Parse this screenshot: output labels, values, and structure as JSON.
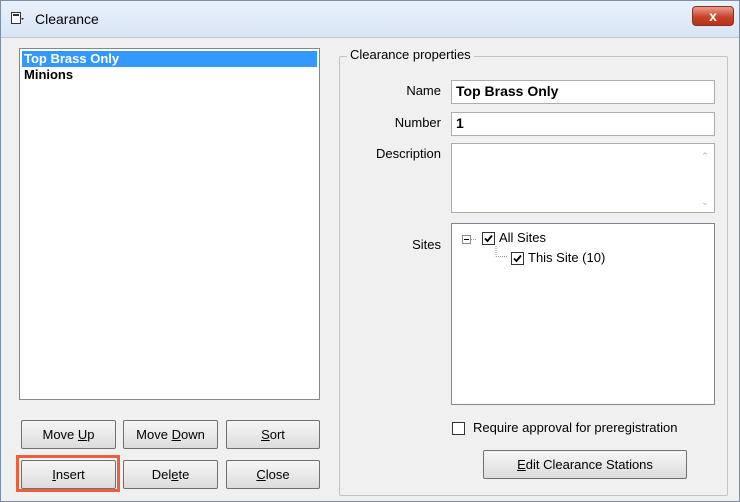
{
  "window": {
    "title": "Clearance",
    "close_label": "x"
  },
  "list": {
    "items": [
      "Top Brass Only",
      "Minions"
    ]
  },
  "buttons": {
    "move_up": {
      "pre": "Move ",
      "key": "U",
      "post": "p"
    },
    "move_down": {
      "pre": "Move ",
      "key": "D",
      "post": "own"
    },
    "sort": {
      "pre": "",
      "key": "S",
      "post": "ort"
    },
    "insert": {
      "pre": "",
      "key": "I",
      "post": "nsert"
    },
    "delete": {
      "pre": "Del",
      "key": "e",
      "post": "te"
    },
    "close": {
      "pre": "",
      "key": "C",
      "post": "lose"
    },
    "edit_stations": {
      "pre": "",
      "key": "E",
      "post": "dit Clearance Stations"
    }
  },
  "properties": {
    "group_title": "Clearance properties",
    "name_label": "Name",
    "name_value": "Top Brass Only",
    "number_label": "Number",
    "number_value": "1",
    "description_label": "Description",
    "description_value": "",
    "sites_label": "Sites",
    "sites_tree": [
      {
        "label": "All Sites",
        "checked": true,
        "expanded": true
      },
      {
        "label": "This Site (10)",
        "checked": true
      }
    ],
    "require_approval_label": "Require approval for preregistration",
    "require_approval_checked": false
  },
  "icons": {
    "app": "window-app-icon",
    "close": "close-icon",
    "check": "checkmark-icon",
    "expander": "minus-expander-icon"
  }
}
